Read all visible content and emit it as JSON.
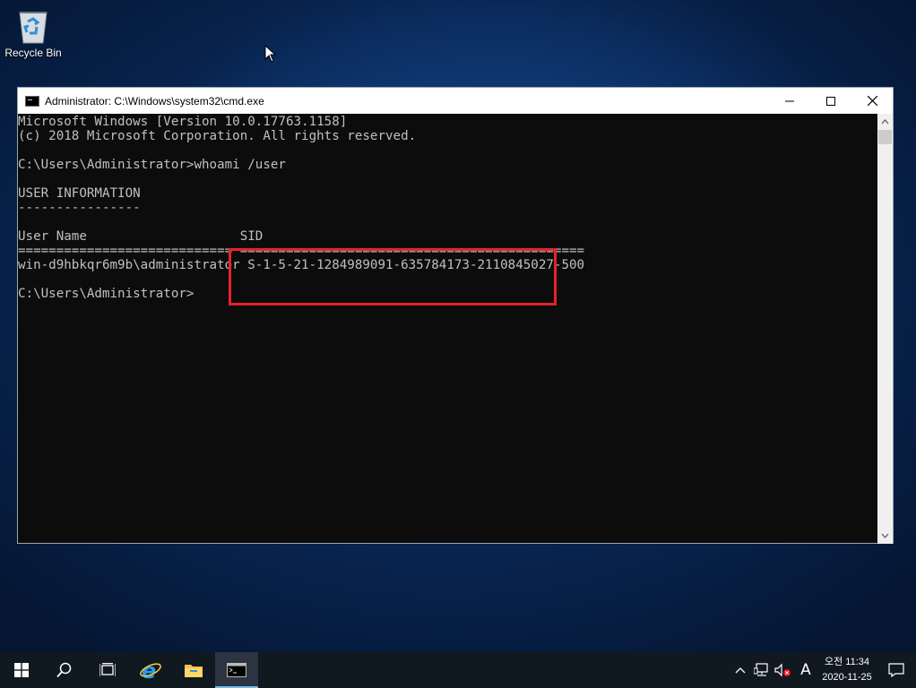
{
  "desktop": {
    "recycle_bin_label": "Recycle Bin"
  },
  "window": {
    "title": "Administrator: C:\\Windows\\system32\\cmd.exe",
    "lines": [
      "Microsoft Windows [Version 10.0.17763.1158]",
      "(c) 2018 Microsoft Corporation. All rights reserved.",
      "",
      "C:\\Users\\Administrator>whoami /user",
      "",
      "USER INFORMATION",
      "----------------",
      "",
      "User Name                    SID",
      "============================ =============================================",
      "win-d9hbkqr6m9b\\administrator S-1-5-21-1284989091-635784173-2110845027-500",
      "",
      "C:\\Users\\Administrator>"
    ]
  },
  "taskbar": {
    "ime_indicator": "A",
    "time": "오전 11:34",
    "date": "2020-11-25"
  },
  "colors": {
    "highlight": "#e8222a",
    "console_bg": "#0c0c0c",
    "console_fg": "#c0c0c0"
  }
}
